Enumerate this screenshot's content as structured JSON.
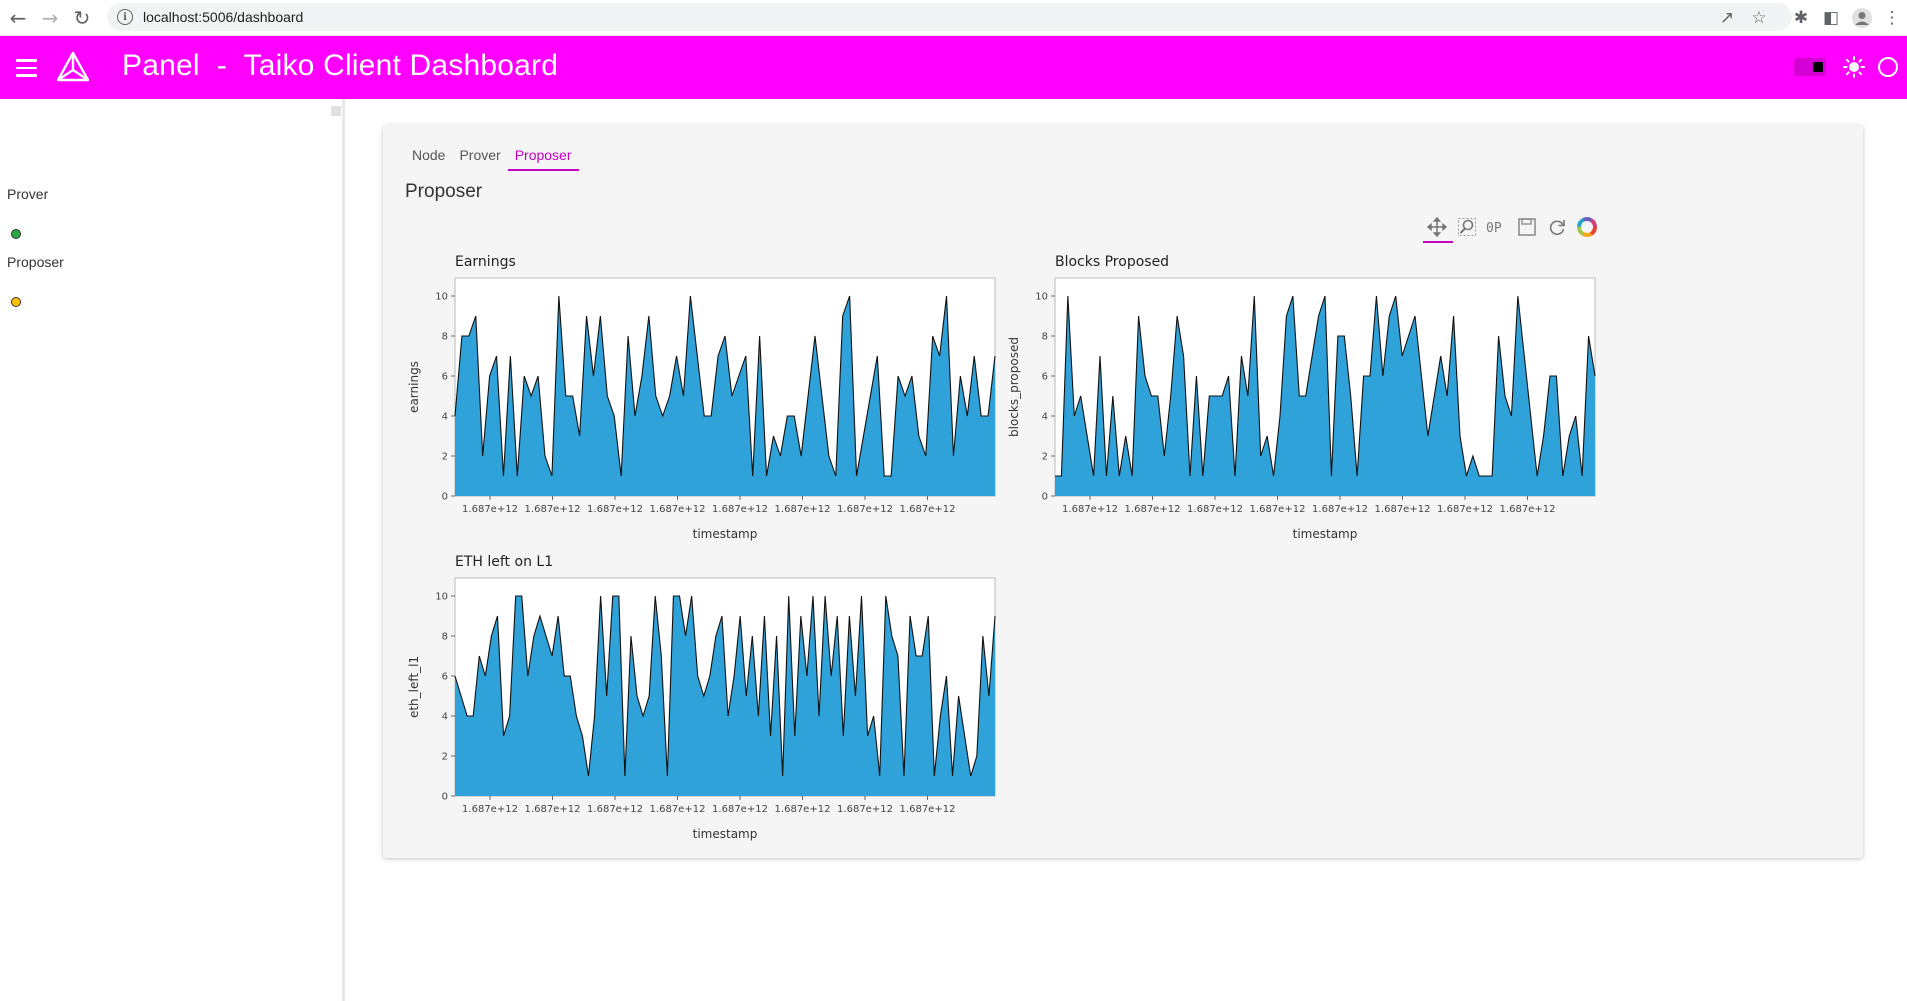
{
  "browser": {
    "url": "localhost:5006/dashboard"
  },
  "header": {
    "title": "Panel  -  Taiko Client Dashboard"
  },
  "sidebar": {
    "items": [
      {
        "label": "Prover",
        "status_color": "#28a745"
      },
      {
        "label": "Proposer",
        "status_color": "#ffc107"
      }
    ]
  },
  "main": {
    "tabs": [
      {
        "label": "Node",
        "active": false
      },
      {
        "label": "Prover",
        "active": false
      },
      {
        "label": "Proposer",
        "active": true
      }
    ],
    "section_title": "Proposer",
    "toolbar": [
      "pan-icon",
      "box-zoom-icon",
      "wheel-zoom-icon",
      "save-icon",
      "reset-icon",
      "bokeh-logo-icon"
    ]
  },
  "colors": {
    "accent": "#ff00ff",
    "area_fill": "#30a2da"
  },
  "chart_data": [
    {
      "type": "area",
      "title": "Earnings",
      "xlabel": "timestamp",
      "ylabel": "earnings",
      "ylim": [
        0,
        10
      ],
      "yticks": [
        0,
        2,
        4,
        6,
        8,
        10
      ],
      "xtick_labels": [
        "1.687e+12",
        "1.687e+12",
        "1.687e+12",
        "1.687e+12",
        "1.687e+12",
        "1.687e+12",
        "1.687e+12",
        "1.687e+12"
      ],
      "values": [
        4,
        8,
        8,
        9,
        2,
        6,
        7,
        1,
        7,
        1,
        6,
        5,
        6,
        2,
        1,
        10,
        5,
        5,
        3,
        9,
        6,
        9,
        5,
        4,
        1,
        8,
        4,
        6,
        9,
        5,
        4,
        5,
        7,
        5,
        10,
        7,
        4,
        4,
        7,
        8,
        5,
        6,
        7,
        1,
        8,
        1,
        3,
        2,
        4,
        4,
        2,
        5,
        8,
        5,
        2,
        1,
        9,
        10,
        1,
        3,
        5,
        7,
        1,
        1,
        6,
        5,
        6,
        3,
        2,
        8,
        7,
        10,
        2,
        6,
        4,
        7,
        4,
        4,
        7
      ]
    },
    {
      "type": "area",
      "title": "Blocks Proposed",
      "xlabel": "timestamp",
      "ylabel": "blocks_proposed",
      "ylim": [
        0,
        10
      ],
      "yticks": [
        0,
        2,
        4,
        6,
        8,
        10
      ],
      "xtick_labels": [
        "1.687e+12",
        "1.687e+12",
        "1.687e+12",
        "1.687e+12",
        "1.687e+12",
        "1.687e+12",
        "1.687e+12",
        "1.687e+12"
      ],
      "values": [
        1,
        1,
        10,
        4,
        5,
        3,
        1,
        7,
        1,
        5,
        1,
        3,
        1,
        9,
        6,
        5,
        5,
        2,
        5,
        9,
        7,
        1,
        6,
        1,
        5,
        5,
        5,
        6,
        1,
        7,
        5,
        10,
        2,
        3,
        1,
        4,
        9,
        10,
        5,
        5,
        7,
        9,
        10,
        1,
        8,
        8,
        5,
        1,
        6,
        6,
        10,
        6,
        9,
        10,
        7,
        8,
        9,
        6,
        3,
        5,
        7,
        5,
        9,
        3,
        1,
        2,
        1,
        1,
        1,
        8,
        5,
        4,
        10,
        7,
        4,
        1,
        3,
        6,
        6,
        1,
        3,
        4,
        1,
        8,
        6
      ]
    },
    {
      "type": "area",
      "title": "ETH left on L1",
      "xlabel": "timestamp",
      "ylabel": "eth_left_l1",
      "ylim": [
        0,
        10
      ],
      "yticks": [
        0,
        2,
        4,
        6,
        8,
        10
      ],
      "xtick_labels": [
        "1.687e+12",
        "1.687e+12",
        "1.687e+12",
        "1.687e+12",
        "1.687e+12",
        "1.687e+12",
        "1.687e+12",
        "1.687e+12"
      ],
      "values": [
        6,
        5,
        4,
        4,
        7,
        6,
        8,
        9,
        3,
        4,
        10,
        10,
        6,
        8,
        9,
        8,
        7,
        9,
        6,
        6,
        4,
        3,
        1,
        4,
        10,
        5,
        10,
        10,
        1,
        8,
        5,
        4,
        5,
        10,
        7,
        1,
        10,
        10,
        8,
        10,
        6,
        5,
        6,
        8,
        9,
        4,
        6,
        9,
        5,
        8,
        4,
        9,
        3,
        8,
        1,
        10,
        3,
        9,
        6,
        10,
        4,
        10,
        6,
        9,
        3,
        9,
        5,
        10,
        3,
        4,
        1,
        10,
        8,
        7,
        1,
        9,
        7,
        7,
        9,
        1,
        4,
        6,
        1,
        5,
        3,
        1,
        2,
        8,
        5,
        9
      ]
    }
  ]
}
